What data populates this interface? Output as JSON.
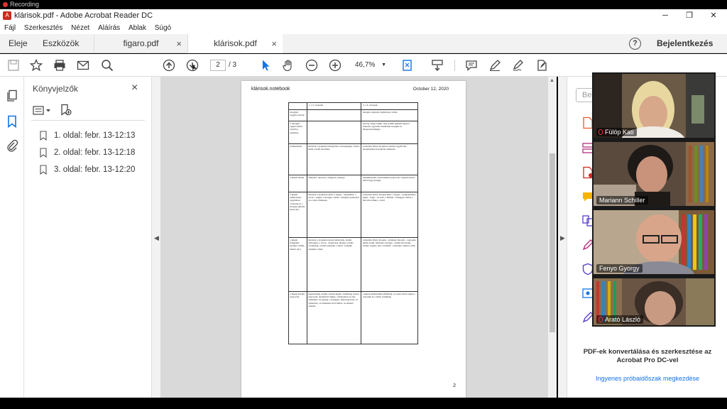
{
  "recording": {
    "label": "Recording"
  },
  "titlebar": {
    "title": "klárisok.pdf - Adobe Acrobat Reader DC",
    "app_icon": "acrobat-icon"
  },
  "window_controls": {
    "minimize": "─",
    "maximize": "❐",
    "close": "✕"
  },
  "menu": [
    "Fájl",
    "Szerkesztés",
    "Nézet",
    "Aláírás",
    "Ablak",
    "Súgó"
  ],
  "tabs": {
    "home": "Eleje",
    "tools": "Eszközök",
    "doc1": "figaro.pdf",
    "doc2": "klárisok.pdf",
    "close_glyph": "×",
    "help": "?",
    "login": "Bejelentkezés"
  },
  "toolbar": {
    "current_page": "2",
    "page_total": "/  3",
    "zoom": "46,7%",
    "zoom_caret": "▼"
  },
  "bookmarks": {
    "title": "Könyvjelzők",
    "close": "×",
    "items": [
      {
        "label": "1. oldal: febr. 13-12:13"
      },
      {
        "label": "2. oldal: febr. 13-12:18"
      },
      {
        "label": "3. oldal: febr. 13-12:20"
      }
    ]
  },
  "document": {
    "header_left": "klárisok.notebook",
    "header_right": "October 12, 2020",
    "page_number": "2",
    "table": {
      "headers": [
        "",
        "1. s 2. versszak",
        "3. s 4. versszak"
      ],
      "rows": [
        [
          "mozgási nagyító szavak",
          "-",
          "mozgás, izgalom, hajladozás, ballas"
        ],
        [
          "a mozgást segítő ritmus szóbőve, jelentése",
          "",
          "mozog, lengi, hajlik, leng, hallik igékből képzett főnevek, egyaránt érzékelteti mozgást és állapotsszerűséget"
        ],
        [
          "párhuzamok",
          "klárisok a nyakadon hiánytalan a keszegséget a hátsó ütem a halál tartalmas",
          "szokatlan lábad, mozgásos hatásos együtt lép, mozgásaihoz hasonlóan ölelkezés"
        ],
        [
          "a képek hatása",
          "álmosító, monoton, ellágyító, kesergő",
          "dinamikusabb, szenvedélyes kapcsolat a képek között, halál tárgy mozgás"
        ],
        [
          "a képek elhelyezése, egyenletes versszak és a mozgás (Kutili, mell stb.)",
          "klárisok a nyakadon kutli, a tenger - nyugalmat, a tavon - ringás, a mozgás a halál - fenséges nyakadon az a rend, ölelkezés",
          "szokatlan lábad, mozgás kutli, a tenger - nyugalomban, ingás - ringó - az erdő, a hullám - fenséges a halál, a táncolás ritmus, a rend"
        ],
        [
          "a képek hangulata (érzéki, vidám, illúzió stb.)",
          "klárisok a nyakadon kerek hiánytalan, érzéki zsibongás, a tavon - ringatózás, ütemes a halál - erőtlenség, a halál szépsége, a halál - bennük, érzésük a lélek",
          "szokatlan lábad, mozgás - érzékeny mozgás - ragyogás, kutlip, halál, lebbenés, mozgás - érzéki szövetség, ritmus, lengés, tánc a halállal - rebbenés, erkölcs, idők"
        ],
        [
          "a képek közötti kapcsolat",
          "képszerűség, érzéki, szabad képek, vidámság, nyitott kapcsolat, álomszerű ritmus, a hiánytalan az élet, ellentétes, az egység, a fenséges, lelki kapcsolat, az alliteráció, az ellentétes lírai ritmus, az ellentét ellentét",
          "a képek párhuzamba állíthatók, az asszociáció alapja a szerelem és a halál, érzékiség"
        ]
      ]
    }
  },
  "right_panel": {
    "search_placeholder": "Be",
    "promo_title": "PDF-ek konvertálása és szerkesztése az Acrobat Pro DC-vel",
    "promo_link": "Ingyenes próbaidőszak megkezdése"
  },
  "participants": [
    {
      "name": "Fülöp Kati",
      "muted": true
    },
    {
      "name": "Mariann Schiller",
      "muted": false
    },
    {
      "name": "Fenyo Gyorgy",
      "muted": false
    },
    {
      "name": "Arató László",
      "muted": true
    }
  ],
  "colors": {
    "accent": "#1473e6",
    "acrobat_red": "#d0281e",
    "mute_red": "#e33333"
  }
}
